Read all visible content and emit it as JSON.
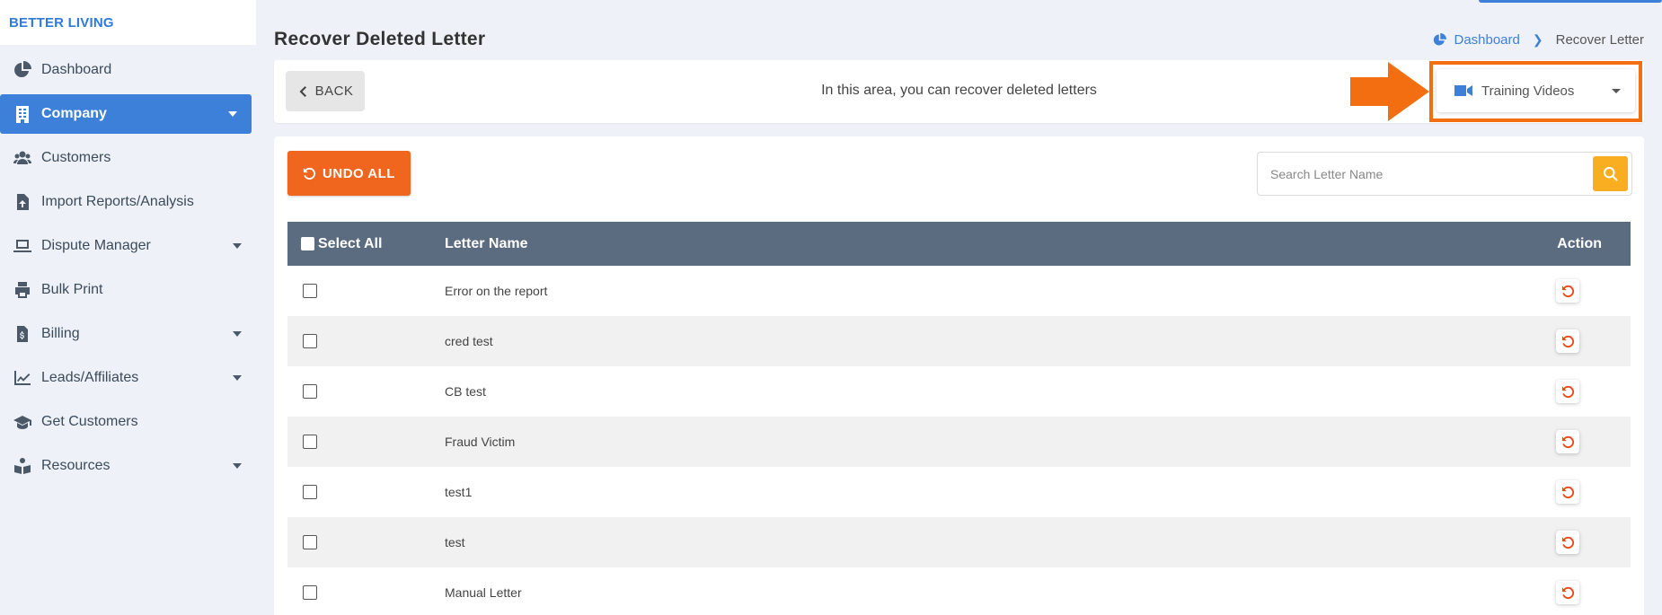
{
  "brand": "BETTER LIVING",
  "sidebar": {
    "items": [
      {
        "label": "Dashboard",
        "icon": "chart-pie-icon"
      },
      {
        "label": "Company",
        "icon": "building-icon",
        "active": true,
        "has_caret": true
      },
      {
        "label": "Customers",
        "icon": "users-icon"
      },
      {
        "label": "Import Reports/Analysis",
        "icon": "file-import-icon"
      },
      {
        "label": "Dispute Manager",
        "icon": "laptop-icon",
        "has_caret": true
      },
      {
        "label": "Bulk Print",
        "icon": "printer-icon"
      },
      {
        "label": "Billing",
        "icon": "invoice-icon",
        "has_caret": true
      },
      {
        "label": "Leads/Affiliates",
        "icon": "chart-line-icon",
        "has_caret": true
      },
      {
        "label": "Get Customers",
        "icon": "graduation-cap-icon"
      },
      {
        "label": "Resources",
        "icon": "book-reader-icon",
        "has_caret": true
      }
    ]
  },
  "page": {
    "title": "Recover Deleted Letter",
    "breadcrumb": {
      "home": "Dashboard",
      "current": "Recover Letter"
    }
  },
  "toolbar": {
    "back_label": "BACK",
    "info": "In this area, you can recover deleted letters",
    "training_videos": "Training Videos"
  },
  "actions": {
    "undo_all": "UNDO ALL",
    "search_placeholder": "Search Letter Name"
  },
  "table": {
    "headers": {
      "select_all": "Select All",
      "letter_name": "Letter Name",
      "action": "Action"
    },
    "rows": [
      {
        "name": "Error on the report"
      },
      {
        "name": "cred test"
      },
      {
        "name": "CB test"
      },
      {
        "name": "Fraud Victim"
      },
      {
        "name": "test1"
      },
      {
        "name": "test"
      },
      {
        "name": "Manual Letter"
      }
    ]
  },
  "colors": {
    "accent": "#3d80d9",
    "undo": "#f0661f",
    "search_button": "#f9ae22",
    "highlight": "#f36e10",
    "table_header": "#5c6c80"
  }
}
